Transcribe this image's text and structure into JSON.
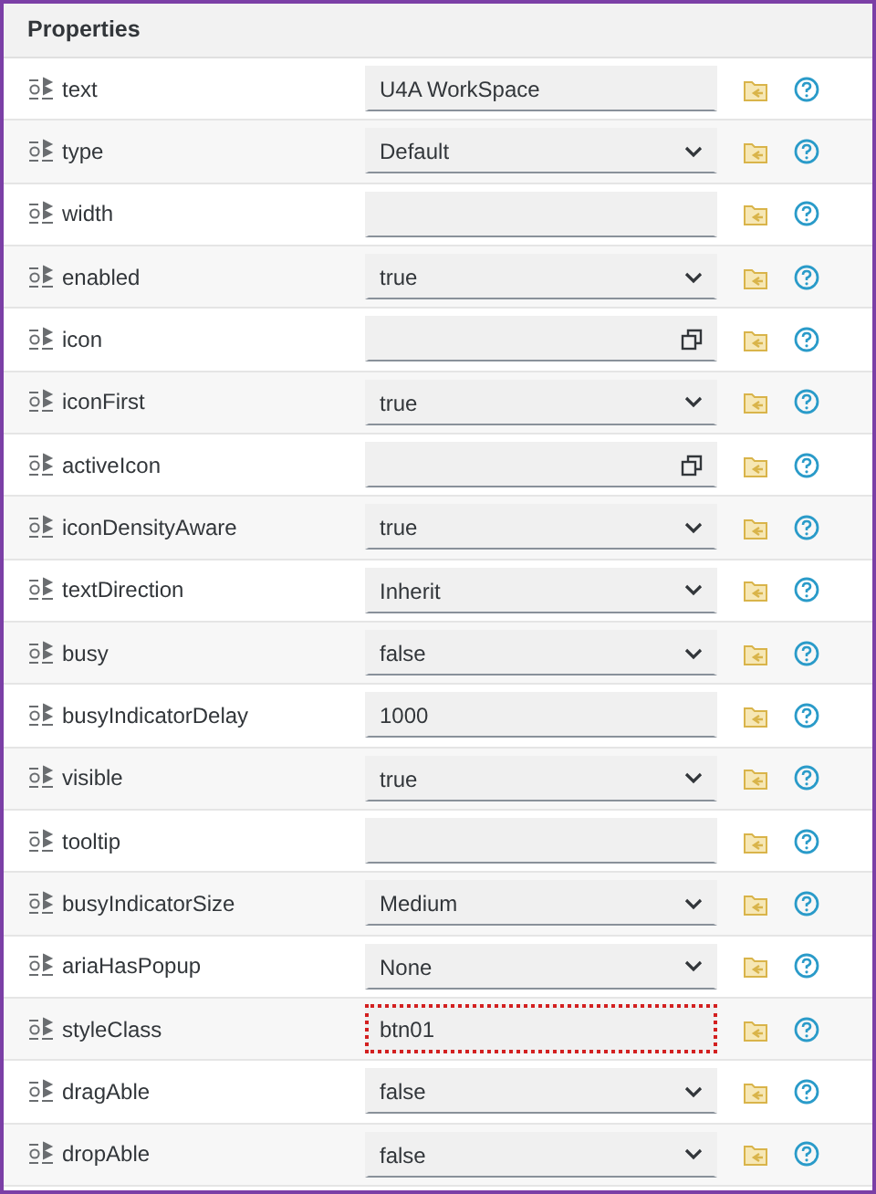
{
  "panel": {
    "title": "Properties"
  },
  "properties": [
    {
      "name": "text",
      "kind": "input",
      "value": "U4A WorkSpace",
      "highlighted": false
    },
    {
      "name": "type",
      "kind": "select",
      "value": "Default",
      "highlighted": false
    },
    {
      "name": "width",
      "kind": "input",
      "highlighted": false
    },
    {
      "name": "enabled",
      "kind": "select",
      "value": "true",
      "highlighted": false
    },
    {
      "name": "icon",
      "kind": "valuehelp",
      "highlighted": false
    },
    {
      "name": "iconFirst",
      "kind": "select",
      "value": "true",
      "highlighted": false
    },
    {
      "name": "activeIcon",
      "kind": "valuehelp",
      "highlighted": false
    },
    {
      "name": "iconDensityAware",
      "kind": "select",
      "value": "true",
      "highlighted": false
    },
    {
      "name": "textDirection",
      "kind": "select",
      "value": "Inherit",
      "highlighted": false
    },
    {
      "name": "busy",
      "kind": "select",
      "value": "false",
      "highlighted": false
    },
    {
      "name": "busyIndicatorDelay",
      "kind": "input",
      "value": "1000",
      "highlighted": false
    },
    {
      "name": "visible",
      "kind": "select",
      "value": "true",
      "highlighted": false
    },
    {
      "name": "tooltip",
      "kind": "input",
      "highlighted": false
    },
    {
      "name": "busyIndicatorSize",
      "kind": "select",
      "value": "Medium",
      "highlighted": false
    },
    {
      "name": "ariaHasPopup",
      "kind": "select",
      "value": "None",
      "highlighted": false
    },
    {
      "name": "styleClass",
      "kind": "input",
      "value": "btn01",
      "highlighted": true
    },
    {
      "name": "dragAble",
      "kind": "select",
      "value": "false",
      "highlighted": false
    },
    {
      "name": "dropAble",
      "kind": "select",
      "value": "false",
      "highlighted": false
    }
  ]
}
